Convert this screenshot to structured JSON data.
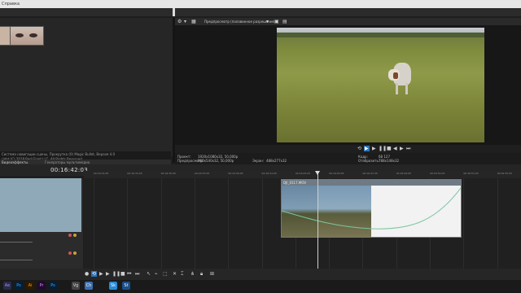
{
  "menubar": {
    "label": "Справка"
  },
  "preview": {
    "quality_label": "Предпросмотр (половинное разрешение)",
    "project_label": "Проект:",
    "project_value": "1920x1080x32, 50,000p",
    "preview_label": "Предпросмотр:",
    "preview_value": "960x540x32, 50,000p",
    "display_label": "Экран:",
    "display_value": "488x277x32",
    "frame_label": "Кадр:",
    "frame_value": "68 127",
    "shown_label": "Отобразить:",
    "shown_value": "788x148x32"
  },
  "media": {
    "info_line1": "Система навигации сцены, Прокрутка (0) Magic Bullet, Версия 4.0",
    "info_line2": "right (C) 2018 Red Giant LLC. All Rights Reserved.",
    "tabs": [
      "Видеоэффекты",
      "Генераторы мультимедиа"
    ]
  },
  "timeline": {
    "timecode": "00:16:42:03",
    "ruler_ticks": [
      "00:16:31:05",
      "00:16:33:05",
      "00:16:35:05",
      "00:16:37:05",
      "00:16:39:05",
      "00:16:41:05",
      "00:16:43:05",
      "00:16:45:05",
      "00:16:47:05",
      "00:16:49:05",
      "00:16:51:05",
      "00:16:53:05",
      "00:16:55:05"
    ],
    "clip_title": "DJI_0117.MOV"
  },
  "taskbar": {
    "apps": [
      "Ae",
      "Ps",
      "Ai",
      "Pr",
      "Ps",
      "Vg",
      "Ch",
      "Sk",
      "St"
    ]
  },
  "colors": {
    "accent": "#2f73b8",
    "clip_header": "#6f7a84"
  }
}
